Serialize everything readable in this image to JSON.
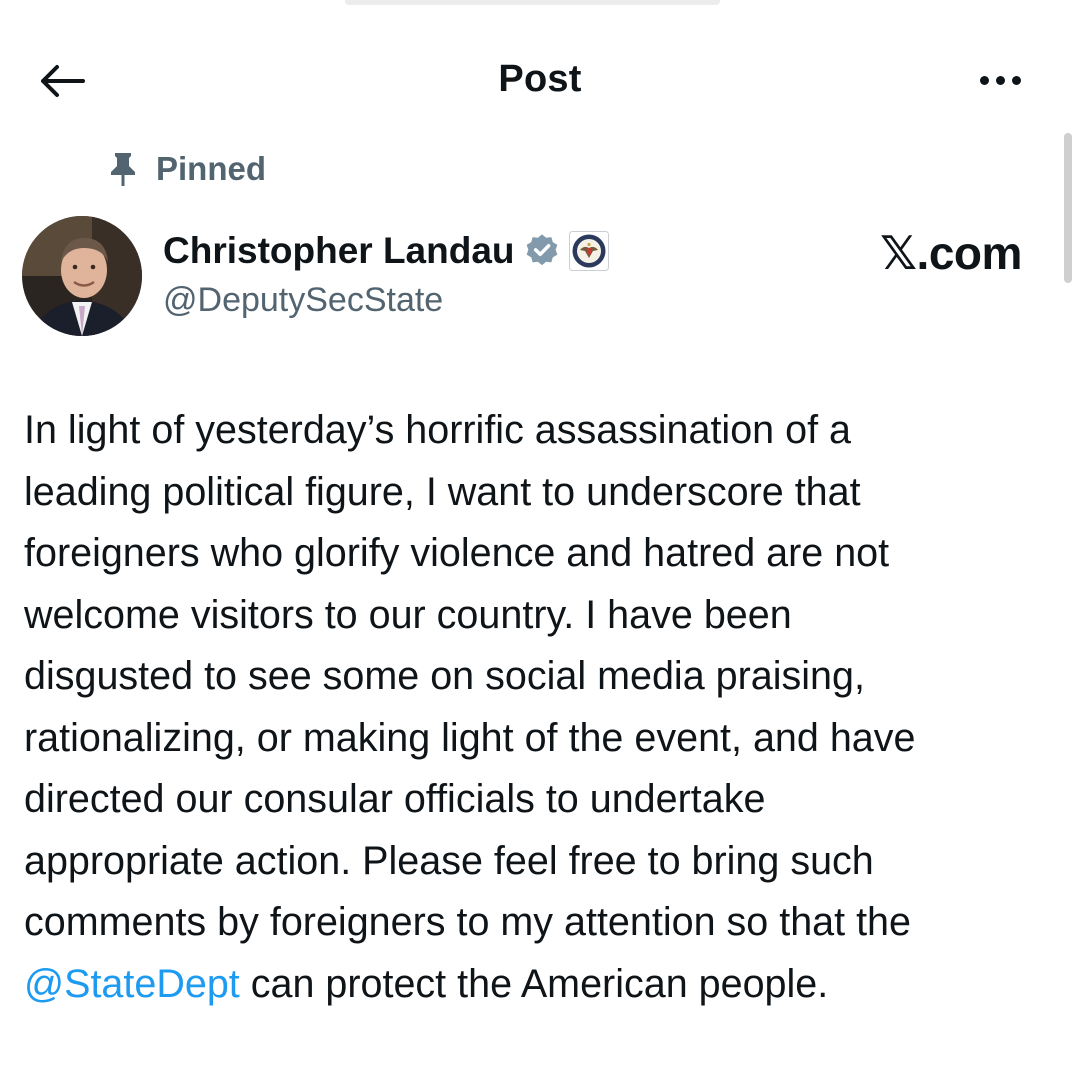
{
  "header": {
    "title": "Post",
    "back_icon": "arrow-left-icon",
    "more_icon": "more-horizontal-icon"
  },
  "post": {
    "pinned_label": "Pinned",
    "pinned_icon": "pin-icon",
    "author": {
      "name": "Christopher Landau",
      "handle": "@DeputySecState",
      "verified_badge": "gray-verified-badge-icon",
      "affiliation_badge": "state-department-seal-icon"
    },
    "text_before_mention": "In light of yesterday’s horrific assassination of a\nleading political figure, I want to underscore that\nforeigners who glorify violence and hatred are not\nwelcome visitors to our country. I have been\ndisgusted to see some on social media praising,\nrationalizing, or making light of the event, and have\ndirected our consular officials to undertake\nappropriate action. Please feel free to bring such\ncomments by foreigners to my attention so that the\n",
    "mention": "@StateDept",
    "text_after_mention": " can protect the American people."
  },
  "watermark": "𝕏.com",
  "colors": {
    "text": "#0f1419",
    "secondary": "#536471",
    "link": "#1d9bf0",
    "badge_gray": "#829aab"
  }
}
